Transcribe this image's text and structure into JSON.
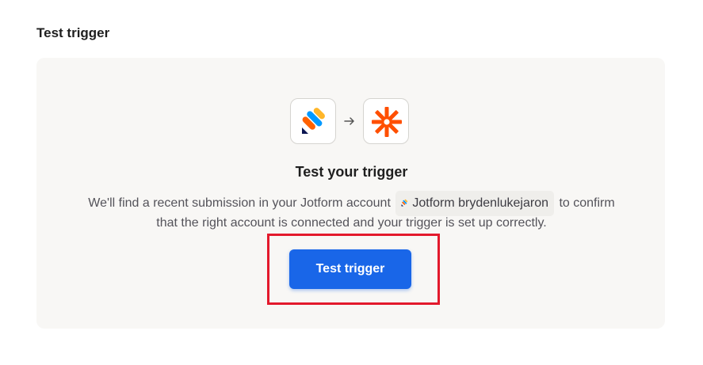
{
  "section": {
    "title": "Test trigger"
  },
  "apps": {
    "source": {
      "icon": "jotform-icon"
    },
    "arrow": {
      "icon": "arrow-right-icon"
    },
    "destination": {
      "icon": "zapier-icon"
    }
  },
  "trigger_test": {
    "heading": "Test your trigger",
    "description_part1": "We'll find a recent submission in your Jotform account",
    "account_chip_label": "Jotform brydenlukejaron",
    "description_part2": "to confirm",
    "description_line2": "that the right account is connected and your trigger is set up correctly.",
    "button_label": "Test trigger"
  },
  "colors": {
    "button": "#1966e8",
    "highlight": "#e3192c",
    "zapier_orange": "#ff4f00",
    "panel_background": "#f8f7f5"
  }
}
